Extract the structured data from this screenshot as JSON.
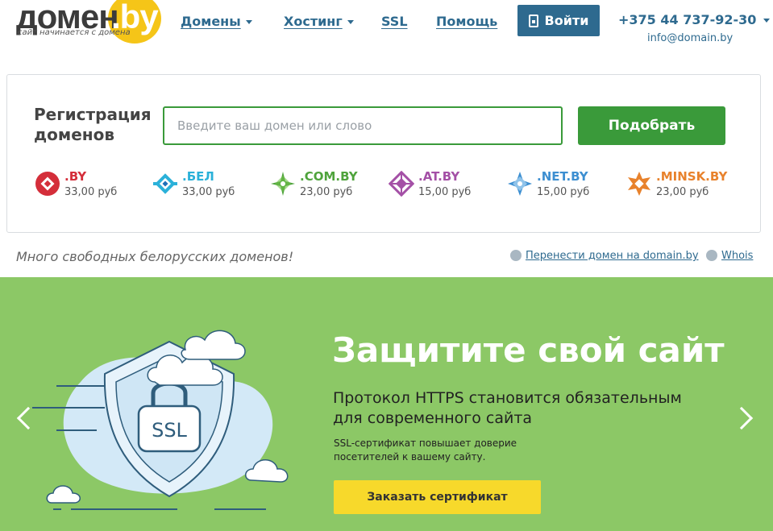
{
  "logo": {
    "word": "домен",
    "tld": ".by",
    "tagline": "сайт начинается с домена"
  },
  "nav": {
    "domains": "Домены",
    "hosting": "Хостинг",
    "ssl": "SSL",
    "help": "Помощь",
    "login": "Войти",
    "phone": "+375 44 737-92-30",
    "email": "info@domain.by"
  },
  "registration": {
    "title": "Регистрация доменов",
    "input_placeholder": "Введите ваш домен или слово",
    "button": "Подобрать",
    "zones": [
      {
        "name": ".BY",
        "price": "33,00 руб",
        "color": "#d42e3a",
        "icon": "by-ornament-icon"
      },
      {
        "name": ".БЕЛ",
        "price": "33,00 руб",
        "color": "#2bb1d9",
        "icon": "bel-ornament-icon"
      },
      {
        "name": ".COM.BY",
        "price": "23,00 руб",
        "color": "#4fa33c",
        "icon": "com-by-ornament-icon"
      },
      {
        "name": ".AT.BY",
        "price": "15,00 руб",
        "color": "#a450a6",
        "icon": "at-by-ornament-icon"
      },
      {
        "name": ".NET.BY",
        "price": "15,00 руб",
        "color": "#3d8fd1",
        "icon": "net-by-ornament-icon"
      },
      {
        "name": ".MINSK.BY",
        "price": "23,00 руб",
        "color": "#e8822c",
        "icon": "minsk-by-ornament-icon"
      }
    ]
  },
  "info": {
    "tagline": "Много свободных белорусских доменов!",
    "transfer_link": "Перенести домен на domain.by",
    "whois_link": "Whois"
  },
  "banner": {
    "title": "Защитите свой сайт",
    "subtitle": "Протокол HTTPS становится обязательным для современного сайта",
    "text": "SSL-сертификат повышает доверие посетителей к вашему сайту.",
    "button": "Заказать сертификат",
    "badge_text": "SSL"
  }
}
